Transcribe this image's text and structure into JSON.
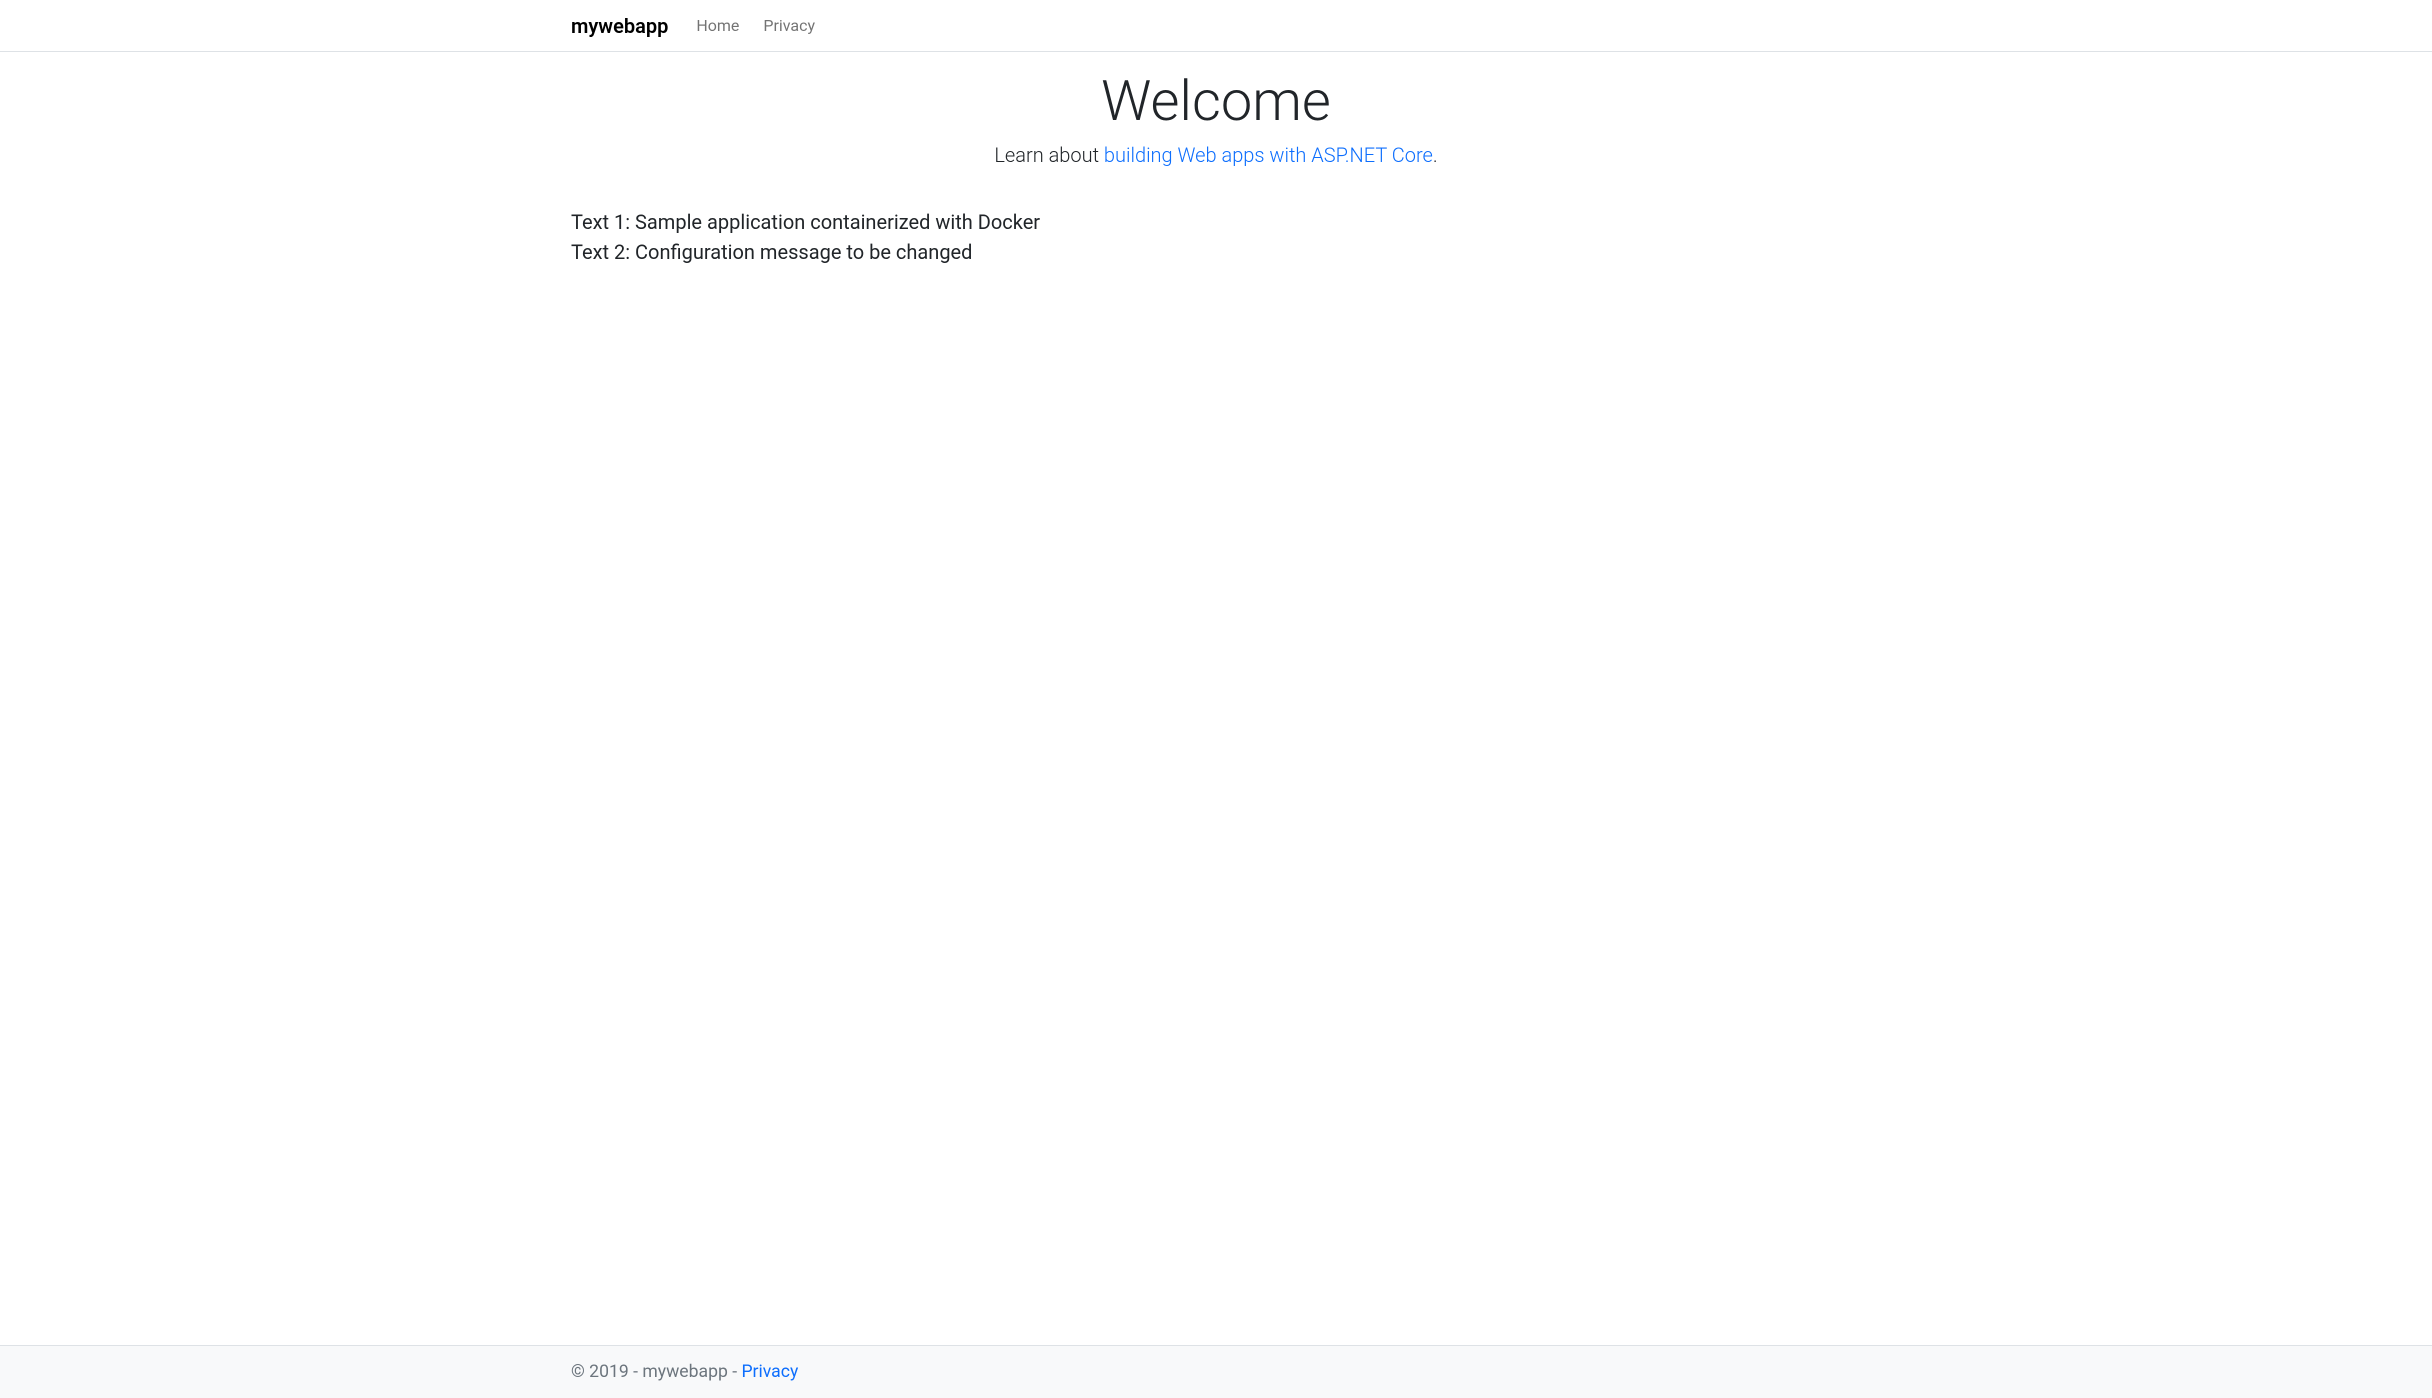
{
  "navbar": {
    "brand": "mywebapp",
    "links": [
      {
        "label": "Home"
      },
      {
        "label": "Privacy"
      }
    ]
  },
  "hero": {
    "title": "Welcome",
    "lead_prefix": "Learn about ",
    "lead_link": "building Web apps with ASP.NET Core",
    "lead_suffix": "."
  },
  "content": {
    "text1": "Text 1: Sample application containerized with Docker",
    "text2": "Text 2: Configuration message to be changed"
  },
  "footer": {
    "copyright": "© 2019 - mywebapp - ",
    "privacy_link": "Privacy"
  }
}
